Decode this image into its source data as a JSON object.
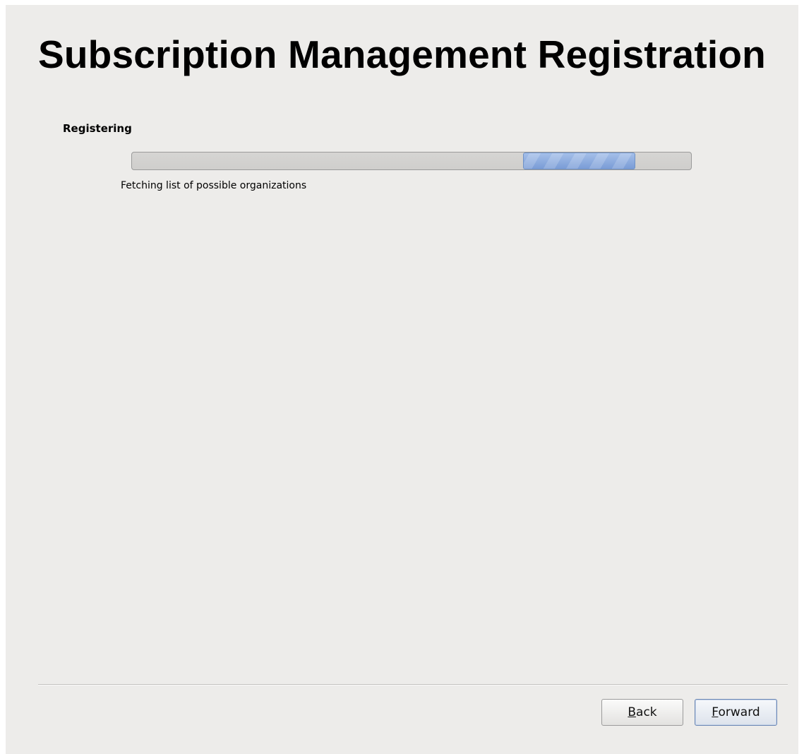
{
  "page": {
    "title": "Subscription Management Registration"
  },
  "registration": {
    "section_title": "Registering",
    "status_text": "Fetching list of possible organizations",
    "progress": {
      "state": "indeterminate",
      "pulse_start_fraction": 0.7,
      "pulse_end_fraction": 0.9,
      "track_color": "#d3d2d0",
      "fill_color": "#8aaae0"
    }
  },
  "buttons": {
    "back": {
      "mnemonic": "B",
      "rest": "ack"
    },
    "forward": {
      "mnemonic": "F",
      "rest": "orward"
    }
  }
}
